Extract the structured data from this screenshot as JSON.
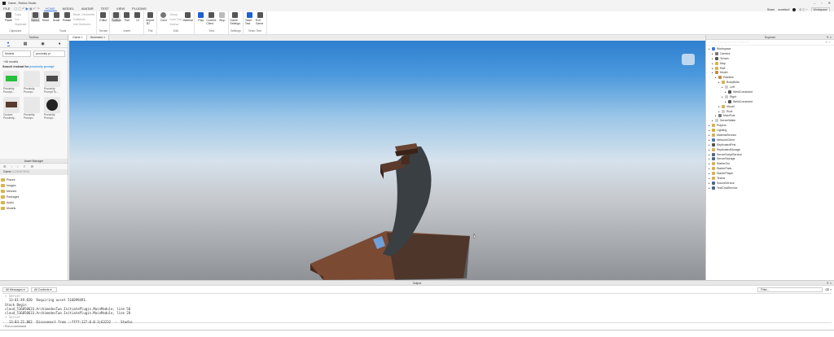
{
  "window": {
    "title": "Game - Roblox Studio",
    "controls": [
      "–",
      "▫",
      "✕"
    ]
  },
  "menu": {
    "file": "FILE",
    "tabs": [
      "HOME",
      "MODEL",
      "AVATAR",
      "TEST",
      "VIEW",
      "PLUGINS"
    ],
    "active": "HOME"
  },
  "user": {
    "share": "Share",
    "username": "occeldorf",
    "workspace": "Workspace"
  },
  "ribbon": {
    "groups": [
      {
        "label": "Clipboard",
        "items": [
          "Paste"
        ],
        "small": [
          "Copy",
          "Cut",
          "Duplicate"
        ]
      },
      {
        "label": "Tools",
        "items": [
          "Select",
          "Move",
          "Scale",
          "Rotate"
        ],
        "small": [
          "Mode: Geometric",
          "Collisions",
          "Join Surfaces"
        ]
      },
      {
        "label": "Terrain",
        "items": [
          "Editor"
        ]
      },
      {
        "label": "Insert",
        "items": [
          "Toolbox",
          "Part",
          "UI"
        ]
      },
      {
        "label": "File",
        "items": [
          "Import 3D"
        ]
      },
      {
        "label": "Edit",
        "items": [
          "Color",
          "Material"
        ],
        "small": [
          "Group",
          "Lock Tool",
          "Anchor"
        ]
      },
      {
        "label": "Test",
        "items": [
          "Play",
          "Current: Client",
          "Stop"
        ]
      },
      {
        "label": "Settings",
        "items": [
          "Game Settings"
        ]
      },
      {
        "label": "Team Test",
        "items": [
          "Team Test",
          "Exit Game"
        ]
      }
    ]
  },
  "toolbox": {
    "title": "Toolbox",
    "category": "Models",
    "search": "proximity pr",
    "count": "+46 models",
    "suggest_prefix": "Search instead for",
    "suggest_term": "proximity prompt",
    "items": [
      "Proximity Prompt...",
      "Proximity Prompt...",
      "Proximity Prompt To...",
      "Custom Proximity...",
      "Proximity Prompt...",
      "Proximity Prompt..."
    ]
  },
  "asset_manager": {
    "title": "Asset Manager",
    "path_label": "Game",
    "path_id": "(1234567890)",
    "folders": [
      "Places",
      "Images",
      "Meshes",
      "Packages",
      "Audio",
      "Models"
    ]
  },
  "viewport": {
    "tabs": [
      "Game",
      "Generator"
    ]
  },
  "explorer": {
    "title": "Explorer",
    "filter": "Filter workspace (Ctrl+Shift+X)",
    "items": [
      {
        "label": "Workspace",
        "depth": 0,
        "color": "#3a78d8"
      },
      {
        "label": "Camera",
        "depth": 1,
        "color": "#777"
      },
      {
        "label": "Terrain",
        "depth": 1,
        "color": "#555"
      },
      {
        "label": "Map",
        "depth": 1,
        "color": "#d9b24c"
      },
      {
        "label": "Raft",
        "depth": 1,
        "color": "#d9b24c"
      },
      {
        "label": "Model",
        "depth": 1,
        "color": "#c84"
      },
      {
        "label": "Paddles",
        "depth": 2,
        "color": "#c84"
      },
      {
        "label": "BodyBolts",
        "depth": 3,
        "color": "#d9b24c"
      },
      {
        "label": "Left",
        "depth": 4,
        "color": "#ccc"
      },
      {
        "label": "WeldConstraint",
        "depth": 5,
        "color": "#555"
      },
      {
        "label": "Right",
        "depth": 4,
        "color": "#ccc"
      },
      {
        "label": "WeldConstraint",
        "depth": 5,
        "color": "#555"
      },
      {
        "label": "Visual",
        "depth": 3,
        "color": "#d9b24c"
      },
      {
        "label": "Root",
        "depth": 3,
        "color": "#ccc"
      },
      {
        "label": "MainPole",
        "depth": 2,
        "color": "#777"
      },
      {
        "label": "ServerWater",
        "depth": 1,
        "color": "#ccc"
      },
      {
        "label": "Players",
        "depth": 0,
        "color": "#d9b24c"
      },
      {
        "label": "Lighting",
        "depth": 0,
        "color": "#e0b020"
      },
      {
        "label": "MaterialService",
        "depth": 0,
        "color": "#d9b24c"
      },
      {
        "label": "NetworkClient",
        "depth": 0,
        "color": "#4a7ab8"
      },
      {
        "label": "ReplicatedFirst",
        "depth": 0,
        "color": "#555"
      },
      {
        "label": "ReplicatedStorage",
        "depth": 0,
        "color": "#d9b24c"
      },
      {
        "label": "ServerScriptService",
        "depth": 0,
        "color": "#4a6a8a"
      },
      {
        "label": "ServerStorage",
        "depth": 0,
        "color": "#4a6a8a"
      },
      {
        "label": "StarterGui",
        "depth": 0,
        "color": "#d9b24c"
      },
      {
        "label": "StarterPack",
        "depth": 0,
        "color": "#d9b24c"
      },
      {
        "label": "StarterPlayer",
        "depth": 0,
        "color": "#d9b24c"
      },
      {
        "label": "Teams",
        "depth": 0,
        "color": "#d9b24c"
      },
      {
        "label": "SoundService",
        "depth": 0,
        "color": "#4a6a8a"
      },
      {
        "label": "TextChatService",
        "depth": 0,
        "color": "#4a6a8a"
      }
    ]
  },
  "output": {
    "title": "Output",
    "filter_messages": "All Messages",
    "filter_contexts": "All Contexts",
    "filter_placeholder": "Filter...",
    "lines": [
      {
        "text": "▾ Server",
        "cls": "gray"
      },
      {
        "text": "  13:01:49.020  Requiring asset 516099491.",
        "cls": ""
      },
      {
        "text": "Stack Begin",
        "cls": ""
      },
      {
        "text": "cloud_516850633.ArchimedesTwo.InitiatePlugin.MainModule, line 50",
        "cls": ""
      },
      {
        "text": "cloud_516850633.ArchimedesTwo.InitiatePlugin.MainModule, line 28",
        "cls": ""
      },
      {
        "text": "▾ Server",
        "cls": "gray"
      },
      {
        "text": "  13:03:21.862  Disconnect from ::ffff:127.0.0.1|63232  -  Studio",
        "cls": ""
      }
    ],
    "command_placeholder": "Run a command"
  }
}
